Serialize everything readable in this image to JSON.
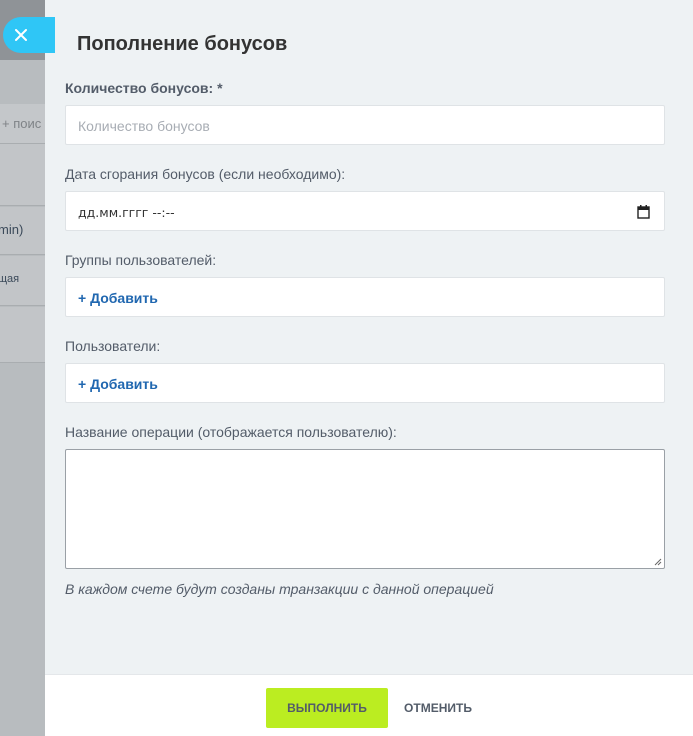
{
  "background": {
    "search_fragment": "+ поис",
    "row_fragment_1": "min)",
    "row_fragment_2": "щая"
  },
  "close_icon": "close-icon",
  "title": "Пополнение бонусов",
  "form": {
    "amount": {
      "label": "Количество бонусов: *",
      "placeholder": "Количество бонусов"
    },
    "expiry": {
      "label": "Дата сгорания бонусов (если необходимо):",
      "value": "дд.мм.гггг --:--",
      "icon": "calendar-icon"
    },
    "groups": {
      "label": "Группы пользователей:",
      "add_label": "+ Добавить"
    },
    "users": {
      "label": "Пользователи:",
      "add_label": "+ Добавить"
    },
    "operation": {
      "label": "Название операции (отображается пользователю):",
      "value": ""
    },
    "hint": "В каждом счете будут созданы транзакции с данной операцией"
  },
  "footer": {
    "run_label": "ВЫПОЛНИТЬ",
    "cancel_label": "ОТМЕНИТЬ"
  },
  "colors": {
    "accent_button": "#bbed21",
    "link": "#2067b0",
    "close_button": "#2fc6f6",
    "panel_bg": "#eef2f4"
  }
}
